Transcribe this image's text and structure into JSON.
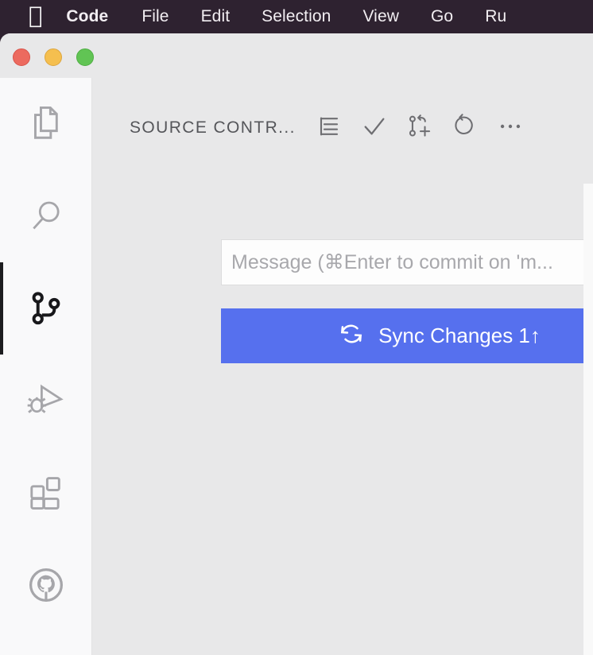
{
  "menubar": {
    "apple_icon": "apple-logo",
    "items": [
      {
        "label": "Code",
        "bold": true
      },
      {
        "label": "File",
        "bold": false
      },
      {
        "label": "Edit",
        "bold": false
      },
      {
        "label": "Selection",
        "bold": false
      },
      {
        "label": "View",
        "bold": false
      },
      {
        "label": "Go",
        "bold": false
      },
      {
        "label": "Ru",
        "bold": false
      }
    ],
    "background": "#2e2230"
  },
  "window": {
    "traffic_lights": [
      {
        "name": "close-button",
        "color": "#ec6a5f"
      },
      {
        "name": "minimize-button",
        "color": "#f5bf4f"
      },
      {
        "name": "maximize-button",
        "color": "#61c454"
      }
    ]
  },
  "activitybar": {
    "items": [
      {
        "icon": "files-icon",
        "label": "Explorer",
        "active": false
      },
      {
        "icon": "search-icon",
        "label": "Search",
        "active": false
      },
      {
        "icon": "source-control-icon",
        "label": "Source Control",
        "active": true
      },
      {
        "icon": "run-and-debug-icon",
        "label": "Run and Debug",
        "active": false
      },
      {
        "icon": "extensions-icon",
        "label": "Extensions",
        "active": false
      },
      {
        "icon": "github-icon",
        "label": "GitHub",
        "active": false
      }
    ]
  },
  "sidebar": {
    "header": {
      "title": "SOURCE CONTR...",
      "actions": [
        {
          "icon": "view-as-list-icon",
          "label": "View as Tree"
        },
        {
          "icon": "check-icon",
          "label": "Commit"
        },
        {
          "icon": "branch-create-icon",
          "label": "Create Branch"
        },
        {
          "icon": "refresh-icon",
          "label": "Refresh"
        },
        {
          "icon": "more-actions-icon",
          "label": "Views and More Actions..."
        }
      ]
    },
    "commit_input": {
      "value": "",
      "placeholder": "Message (⌘Enter to commit on 'm..."
    },
    "sync_button": {
      "label": "Sync Changes 1↑",
      "icon": "sync-icon",
      "color": "#5670ee"
    }
  }
}
